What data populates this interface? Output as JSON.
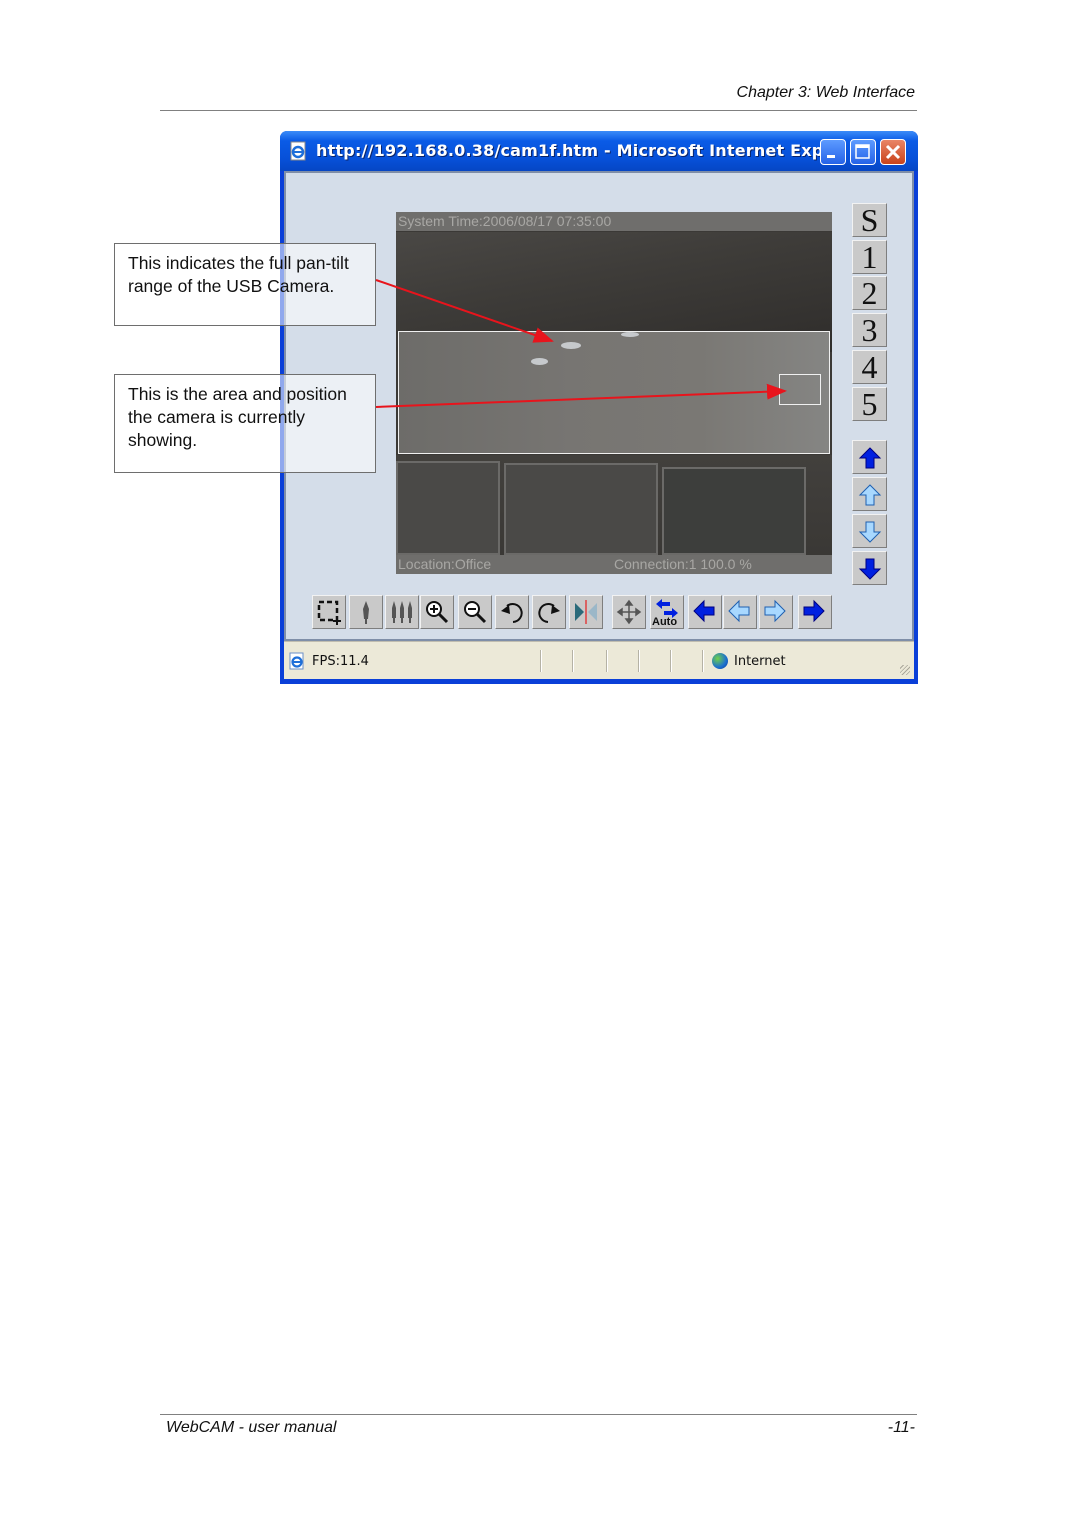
{
  "page": {
    "header": "Chapter 3: Web Interface",
    "footer_left": "WebCAM - user manual",
    "footer_right": "-11-"
  },
  "window": {
    "title": "http://192.168.0.38/cam1f.htm - Microsoft Internet Exp...",
    "buttons": {
      "minimize": "minimize",
      "maximize": "maximize",
      "close": "close"
    }
  },
  "video": {
    "osd_time": "System Time:2006/08/17 07:35:00",
    "osd_location": "Location:Office",
    "osd_connection": "Connection:1  100.0 %"
  },
  "presets": [
    "S",
    "1",
    "2",
    "3",
    "4",
    "5"
  ],
  "tilt_buttons": [
    {
      "name": "tilt-up-fast",
      "icon": "arrow-up-solid"
    },
    {
      "name": "tilt-up-step",
      "icon": "arrow-up-outline"
    },
    {
      "name": "tilt-down-step",
      "icon": "arrow-down-outline"
    },
    {
      "name": "tilt-down-fast",
      "icon": "arrow-down-solid"
    }
  ],
  "toolbar": [
    {
      "name": "select-area",
      "icon": "selection-icon"
    },
    {
      "name": "single-view",
      "icon": "single-figure-icon"
    },
    {
      "name": "multi-view",
      "icon": "multi-figure-icon"
    },
    {
      "name": "zoom-in",
      "icon": "zoom-in-icon"
    },
    {
      "name": "zoom-out",
      "icon": "zoom-out-icon"
    },
    {
      "name": "rotate-left",
      "icon": "rotate-ccw-icon"
    },
    {
      "name": "rotate-right",
      "icon": "rotate-cw-icon"
    },
    {
      "name": "mirror",
      "icon": "mirror-icon"
    },
    {
      "name": "center",
      "icon": "move-icon"
    },
    {
      "name": "auto-pan",
      "icon": "auto-pan-icon",
      "label": "Auto"
    },
    {
      "name": "pan-left-fast",
      "icon": "arrow-left-solid"
    },
    {
      "name": "pan-left-step",
      "icon": "arrow-left-outline"
    },
    {
      "name": "pan-right-step",
      "icon": "arrow-right-outline"
    },
    {
      "name": "pan-right-fast",
      "icon": "arrow-right-solid"
    }
  ],
  "statusbar": {
    "fps": "FPS:11.4",
    "zone": "Internet"
  },
  "callouts": [
    "This indicates the full pan-tilt range of the USB Camera.",
    "This is the area and position the camera is currently showing."
  ],
  "colors": {
    "arrow": "#e8141c",
    "titlebar": "#0a5be6",
    "icon_blue_solid": "#0020e0",
    "icon_blue_light": "#a8d8ff"
  }
}
